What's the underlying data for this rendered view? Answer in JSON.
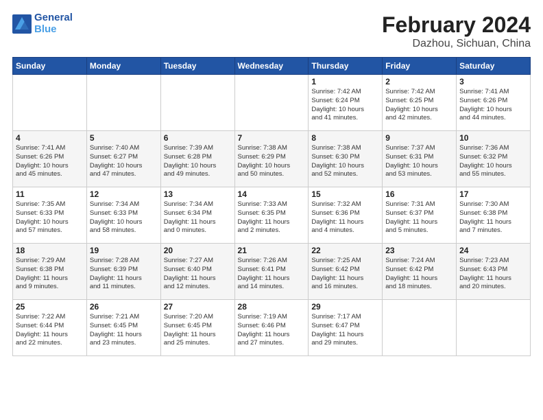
{
  "header": {
    "logo_line1": "General",
    "logo_line2": "Blue",
    "title": "February 2024",
    "subtitle": "Dazhou, Sichuan, China"
  },
  "weekdays": [
    "Sunday",
    "Monday",
    "Tuesday",
    "Wednesday",
    "Thursday",
    "Friday",
    "Saturday"
  ],
  "weeks": [
    [
      {
        "day": "",
        "info": ""
      },
      {
        "day": "",
        "info": ""
      },
      {
        "day": "",
        "info": ""
      },
      {
        "day": "",
        "info": ""
      },
      {
        "day": "1",
        "info": "Sunrise: 7:42 AM\nSunset: 6:24 PM\nDaylight: 10 hours\nand 41 minutes."
      },
      {
        "day": "2",
        "info": "Sunrise: 7:42 AM\nSunset: 6:25 PM\nDaylight: 10 hours\nand 42 minutes."
      },
      {
        "day": "3",
        "info": "Sunrise: 7:41 AM\nSunset: 6:26 PM\nDaylight: 10 hours\nand 44 minutes."
      }
    ],
    [
      {
        "day": "4",
        "info": "Sunrise: 7:41 AM\nSunset: 6:26 PM\nDaylight: 10 hours\nand 45 minutes."
      },
      {
        "day": "5",
        "info": "Sunrise: 7:40 AM\nSunset: 6:27 PM\nDaylight: 10 hours\nand 47 minutes."
      },
      {
        "day": "6",
        "info": "Sunrise: 7:39 AM\nSunset: 6:28 PM\nDaylight: 10 hours\nand 49 minutes."
      },
      {
        "day": "7",
        "info": "Sunrise: 7:38 AM\nSunset: 6:29 PM\nDaylight: 10 hours\nand 50 minutes."
      },
      {
        "day": "8",
        "info": "Sunrise: 7:38 AM\nSunset: 6:30 PM\nDaylight: 10 hours\nand 52 minutes."
      },
      {
        "day": "9",
        "info": "Sunrise: 7:37 AM\nSunset: 6:31 PM\nDaylight: 10 hours\nand 53 minutes."
      },
      {
        "day": "10",
        "info": "Sunrise: 7:36 AM\nSunset: 6:32 PM\nDaylight: 10 hours\nand 55 minutes."
      }
    ],
    [
      {
        "day": "11",
        "info": "Sunrise: 7:35 AM\nSunset: 6:33 PM\nDaylight: 10 hours\nand 57 minutes."
      },
      {
        "day": "12",
        "info": "Sunrise: 7:34 AM\nSunset: 6:33 PM\nDaylight: 10 hours\nand 58 minutes."
      },
      {
        "day": "13",
        "info": "Sunrise: 7:34 AM\nSunset: 6:34 PM\nDaylight: 11 hours\nand 0 minutes."
      },
      {
        "day": "14",
        "info": "Sunrise: 7:33 AM\nSunset: 6:35 PM\nDaylight: 11 hours\nand 2 minutes."
      },
      {
        "day": "15",
        "info": "Sunrise: 7:32 AM\nSunset: 6:36 PM\nDaylight: 11 hours\nand 4 minutes."
      },
      {
        "day": "16",
        "info": "Sunrise: 7:31 AM\nSunset: 6:37 PM\nDaylight: 11 hours\nand 5 minutes."
      },
      {
        "day": "17",
        "info": "Sunrise: 7:30 AM\nSunset: 6:38 PM\nDaylight: 11 hours\nand 7 minutes."
      }
    ],
    [
      {
        "day": "18",
        "info": "Sunrise: 7:29 AM\nSunset: 6:38 PM\nDaylight: 11 hours\nand 9 minutes."
      },
      {
        "day": "19",
        "info": "Sunrise: 7:28 AM\nSunset: 6:39 PM\nDaylight: 11 hours\nand 11 minutes."
      },
      {
        "day": "20",
        "info": "Sunrise: 7:27 AM\nSunset: 6:40 PM\nDaylight: 11 hours\nand 12 minutes."
      },
      {
        "day": "21",
        "info": "Sunrise: 7:26 AM\nSunset: 6:41 PM\nDaylight: 11 hours\nand 14 minutes."
      },
      {
        "day": "22",
        "info": "Sunrise: 7:25 AM\nSunset: 6:42 PM\nDaylight: 11 hours\nand 16 minutes."
      },
      {
        "day": "23",
        "info": "Sunrise: 7:24 AM\nSunset: 6:42 PM\nDaylight: 11 hours\nand 18 minutes."
      },
      {
        "day": "24",
        "info": "Sunrise: 7:23 AM\nSunset: 6:43 PM\nDaylight: 11 hours\nand 20 minutes."
      }
    ],
    [
      {
        "day": "25",
        "info": "Sunrise: 7:22 AM\nSunset: 6:44 PM\nDaylight: 11 hours\nand 22 minutes."
      },
      {
        "day": "26",
        "info": "Sunrise: 7:21 AM\nSunset: 6:45 PM\nDaylight: 11 hours\nand 23 minutes."
      },
      {
        "day": "27",
        "info": "Sunrise: 7:20 AM\nSunset: 6:45 PM\nDaylight: 11 hours\nand 25 minutes."
      },
      {
        "day": "28",
        "info": "Sunrise: 7:19 AM\nSunset: 6:46 PM\nDaylight: 11 hours\nand 27 minutes."
      },
      {
        "day": "29",
        "info": "Sunrise: 7:17 AM\nSunset: 6:47 PM\nDaylight: 11 hours\nand 29 minutes."
      },
      {
        "day": "",
        "info": ""
      },
      {
        "day": "",
        "info": ""
      }
    ]
  ]
}
